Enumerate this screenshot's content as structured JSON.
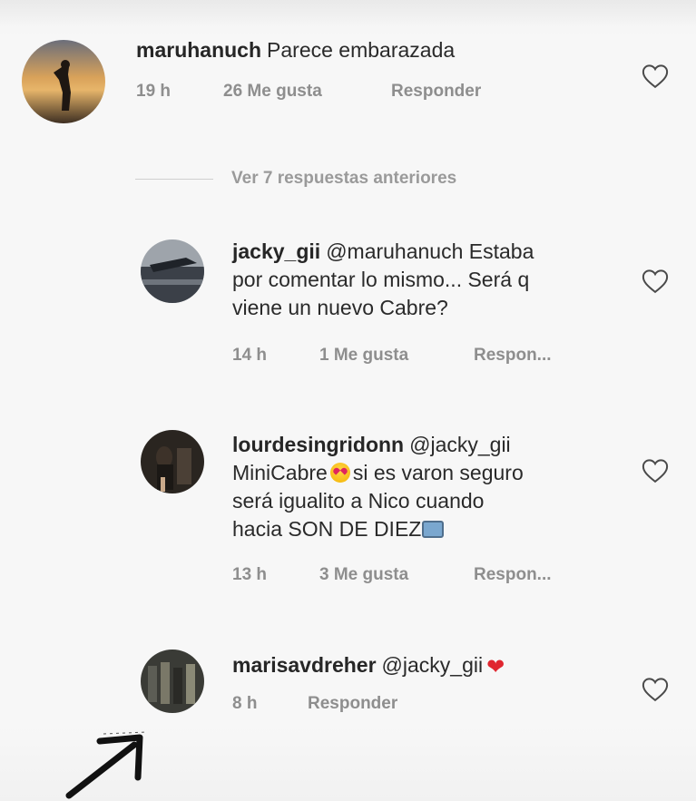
{
  "comments": [
    {
      "username": "maruhanuch",
      "text": "Parece embarazada",
      "time": "19 h",
      "likes": "26 Me gusta",
      "reply": "Responder",
      "avatar": "sunset-silhouette"
    }
  ],
  "view_replies": "Ver 7 respuestas anteriores",
  "replies": [
    {
      "username": "jacky_gii",
      "line1": "@maruhanuch Estaba",
      "line2": "por comentar lo mismo... Será q",
      "line3": "viene un nuevo Cabre?",
      "time": "14 h",
      "likes": "1 Me gusta",
      "reply": "Respon..."
    },
    {
      "username": "lourdesingridonn",
      "line1": "@jacky_gii",
      "line2a": "MiniCabre",
      "line2b": "si es varon seguro",
      "line3": "será igualito a Nico cuando",
      "line4": "hacia SON DE DIEZ",
      "time": "13 h",
      "likes": "3 Me gusta",
      "reply": "Respon..."
    },
    {
      "username": "marisavdreher",
      "line1": "@jacky_gii",
      "time": "8 h",
      "reply": "Responder"
    }
  ],
  "icons": {
    "like": "heart-outline-icon",
    "emoji_love": "heart-eyes-emoji",
    "emoji_tv": "television-emoji",
    "emoji_heart": "red-heart-emoji"
  },
  "colors": {
    "text": "#262626",
    "meta": "#8e8e8e",
    "heart_red": "#e0262f"
  }
}
